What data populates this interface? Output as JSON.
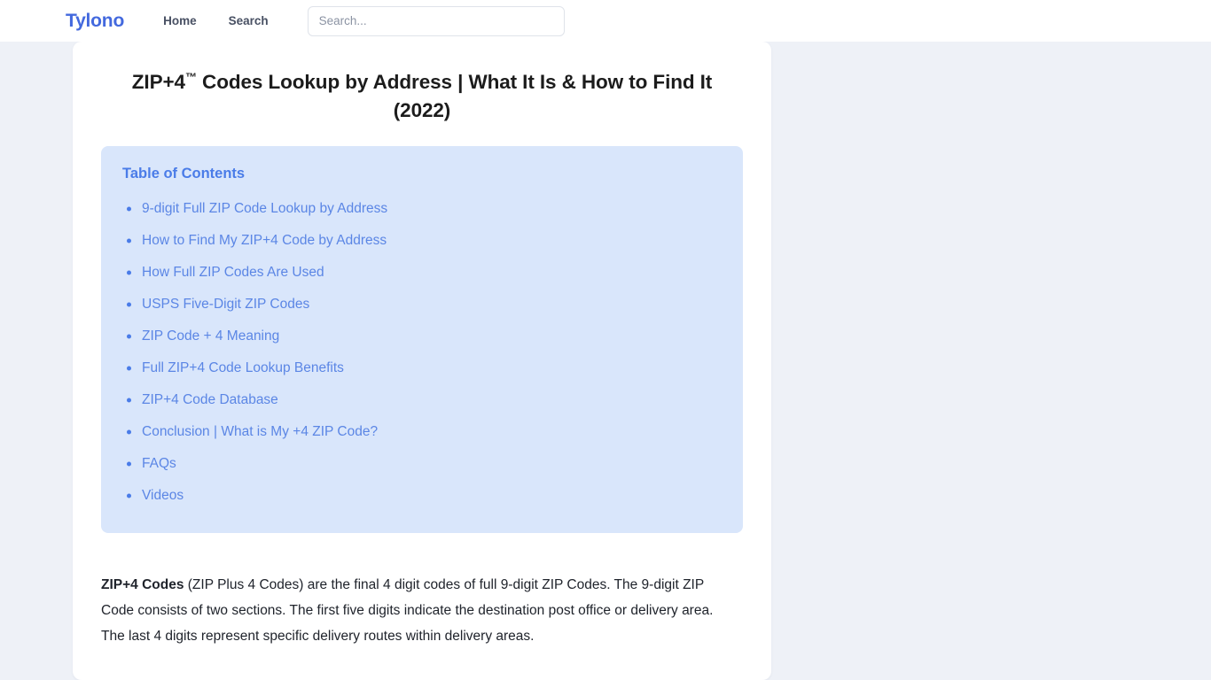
{
  "header": {
    "brand": "Tylono",
    "nav": [
      {
        "label": "Home",
        "name": "nav-link-home"
      },
      {
        "label": "Search",
        "name": "nav-link-search"
      }
    ],
    "search": {
      "placeholder": "Search...",
      "value": ""
    }
  },
  "article": {
    "title_pre": "ZIP+4",
    "title_tm": "™",
    "title_post": " Codes Lookup by Address | What It Is & How to Find It (2022)",
    "title_full": "ZIP+4™ Codes Lookup by Address | What It Is & How to Find It (2022)"
  },
  "toc": {
    "heading": "Table of Contents",
    "items": [
      {
        "label": "9-digit Full ZIP Code Lookup by Address"
      },
      {
        "label": "How to Find My ZIP+4 Code by Address"
      },
      {
        "label": "How Full ZIP Codes Are Used"
      },
      {
        "label": "USPS Five-Digit ZIP Codes"
      },
      {
        "label": "ZIP Code + 4 Meaning"
      },
      {
        "label": "Full ZIP+4 Code Lookup Benefits"
      },
      {
        "label": "ZIP+4 Code Database"
      },
      {
        "label": "Conclusion | What is My +4 ZIP Code?"
      },
      {
        "label": "FAQs"
      },
      {
        "label": "Videos"
      }
    ]
  },
  "content": {
    "paragraph_lead": "ZIP+4 Codes",
    "paragraph_rest": " (ZIP Plus 4 Codes) are the final 4 digit codes of full 9-digit ZIP Codes. The 9-digit ZIP Code consists of two sections. The first five digits indicate the destination post office or delivery area. The last 4 digits represent specific delivery routes within delivery areas."
  },
  "colors": {
    "brand": "#4369de",
    "page_background": "#eef1f7",
    "card_background": "#ffffff",
    "toc_background": "#d9e6fb",
    "toc_heading": "#4a7ce8",
    "toc_link": "#5b86e5",
    "nav_text": "#485063",
    "body_text": "#20242c"
  }
}
